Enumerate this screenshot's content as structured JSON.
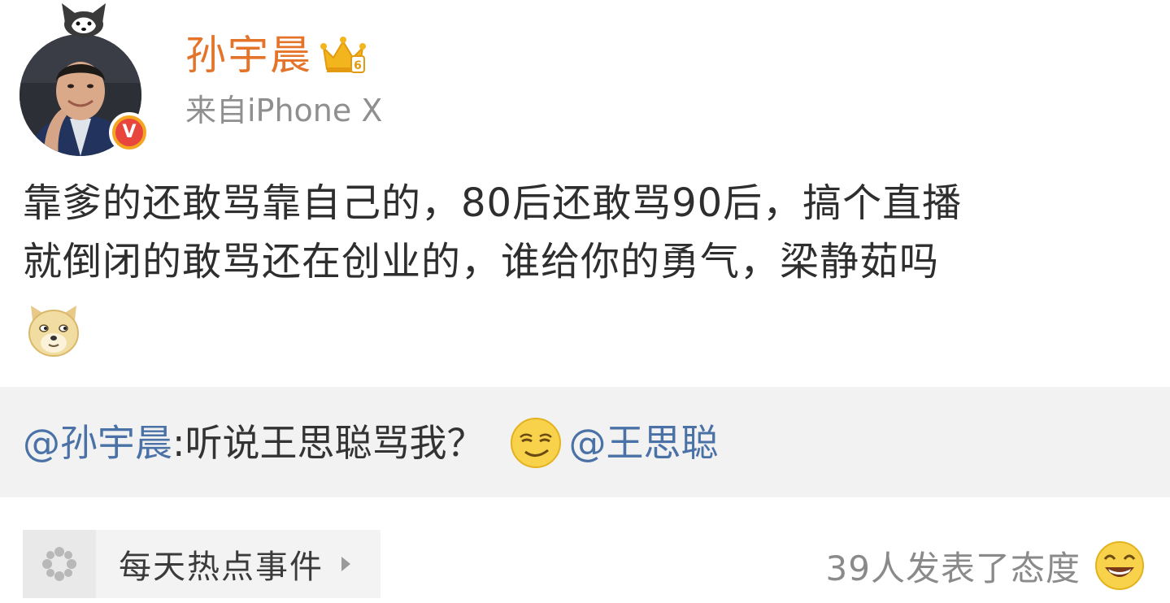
{
  "user": {
    "name": "孙宇晨",
    "source": "来自iPhone X"
  },
  "post": {
    "lines": [
      "靠爹的还敢骂靠自己的，80后还敢骂90后，搞个直播",
      "就倒闭的敢骂还在创业的，谁给你的勇气，梁静茹吗"
    ]
  },
  "quote": {
    "mention_author": "@孙宇晨",
    "text": ":听说王思聪骂我？",
    "mention_target": "@王思聪"
  },
  "footer": {
    "topic": "每天热点事件",
    "reactions": "39人发表了态度"
  },
  "icons": {
    "verified": "verified-v-badge-icon",
    "crown": "vip-crown-icon",
    "doge": "doge-emoji-icon",
    "smirk": "smirk-emoji-icon",
    "topic": "topic-flower-icon",
    "laugh": "laugh-emoji-icon"
  },
  "colors": {
    "username": "#e3742a",
    "mention": "#4a72a6",
    "verified_outer": "#f4a620",
    "verified_inner": "#e8453c",
    "quote_bg": "#f2f2f2"
  }
}
